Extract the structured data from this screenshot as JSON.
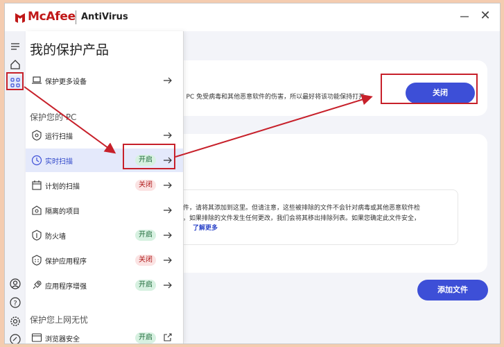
{
  "titlebar": {
    "brand": "McAfee",
    "product": "AntiVirus"
  },
  "menu": {
    "title": "我的保护产品",
    "item_more_devices": "保护更多设备",
    "section_pc": "保护您的 PC",
    "items": [
      {
        "label": "运行扫描",
        "badge": ""
      },
      {
        "label": "实时扫描",
        "badge": "开启"
      },
      {
        "label": "计划的扫描",
        "badge": "关闭"
      },
      {
        "label": "隔离的项目",
        "badge": ""
      },
      {
        "label": "防火墙",
        "badge": "开启"
      },
      {
        "label": "保护应用程序",
        "badge": "关闭"
      },
      {
        "label": "应用程序增强",
        "badge": "开启"
      }
    ],
    "section_web": "保护您上网无忧",
    "browser_item": {
      "label": "浏览器安全",
      "badge": "开启"
    }
  },
  "main": {
    "card1_text": "J PC 免受病毒和其他恶意软件的伤害，所以最好将该功能保持打开",
    "close_button": "关闭",
    "card2_line1": "件，请将其添加到这里。但请注意，这些被排除的文件不会针对病毒或其他恶意软件检",
    "card2_line2": "。如果排除的文件发生任何更改，我们会将其移出排除列表。如果您确定此文件安全，",
    "learn_more": "了解更多",
    "add_file_button": "添加文件"
  },
  "colors": {
    "accent": "#3d4fd7",
    "brand_red": "#c01818",
    "annotation_red": "#c7202a",
    "on_bg": "#d7f1e1",
    "off_bg": "#fbe3e3"
  },
  "icons": {
    "rail": [
      "menu-icon",
      "home-icon",
      "apps-icon",
      "account-icon",
      "help-icon",
      "settings-icon",
      "feedback-icon"
    ]
  }
}
